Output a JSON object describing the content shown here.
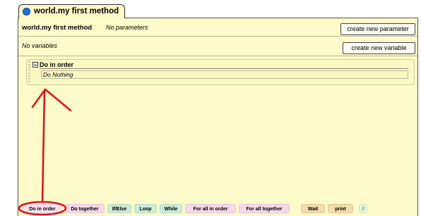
{
  "tab": {
    "title": "world.my first method"
  },
  "header": {
    "method_name": "world.my first method",
    "params_text": "No parameters",
    "create_param_label": "create new parameter"
  },
  "variables": {
    "empty_text": "No variables",
    "create_var_label": "create new variable"
  },
  "block": {
    "title": "Do in order",
    "placeholder": "Do Nothing"
  },
  "palette": {
    "items": [
      {
        "label": "Do in order"
      },
      {
        "label": "Do together"
      },
      {
        "label": "If/Else"
      },
      {
        "label": "Loop"
      },
      {
        "label": "While"
      },
      {
        "label": "For all in order"
      },
      {
        "label": "For all together"
      },
      {
        "label": "Wait"
      },
      {
        "label": "print"
      },
      {
        "label": "//"
      }
    ]
  },
  "colors": {
    "panel_bg": "#fdfbc9",
    "annotation_red": "#e0151b",
    "tab_icon_blue": "#1f6fe0"
  }
}
